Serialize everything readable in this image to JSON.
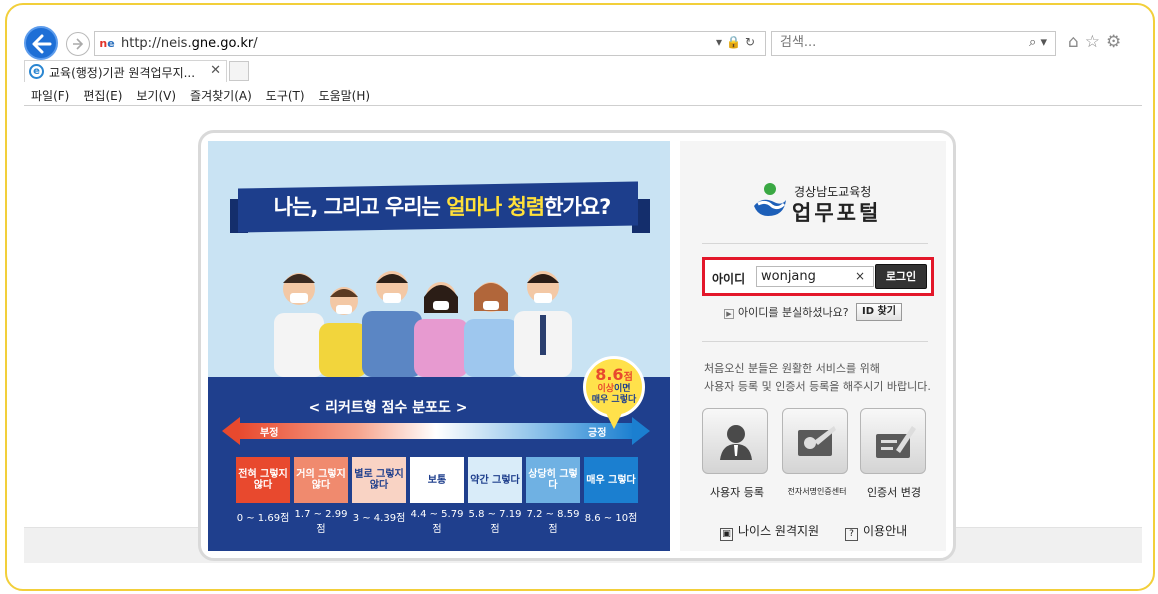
{
  "browser": {
    "url_prefix": "http://neis.",
    "url_domain": "gne.go.kr",
    "url_suffix": "/",
    "search_placeholder": "검색...",
    "tab_title": "교육(행정)기관 원격업무지...",
    "menu": [
      "파일(F)",
      "편집(E)",
      "보기(V)",
      "즐겨찾기(A)",
      "도구(T)",
      "도움말(H)"
    ]
  },
  "banner": {
    "title_pre": "나는, 그리고 우리는 ",
    "title_hl": "얼마나 청렴",
    "title_post": "한가요?",
    "likert_title": "< 리커트형 점수 분포도 >",
    "negative": "부정",
    "positive": "긍정",
    "scale": [
      {
        "label": "전혀 그렇지 않다",
        "range": "0 ~ 1.69점",
        "color": "#e8492e"
      },
      {
        "label": "거의 그렇지 않다",
        "range": "1.7 ~ 2.99점",
        "color": "#f08a6e"
      },
      {
        "label": "별로 그렇지 않다",
        "range": "3 ~ 4.39점",
        "color": "#f9d3c4"
      },
      {
        "label": "보통",
        "range": "4.4 ~ 5.79점",
        "color": "#1f3f8d"
      },
      {
        "label": "약간 그렇다",
        "range": "5.8 ~ 7.19점",
        "color": "#d9ecf9"
      },
      {
        "label": "상당히 그렇다",
        "range": "7.2 ~ 8.59점",
        "color": "#6fb1e3"
      },
      {
        "label": "매우 그렇다",
        "range": "8.6 ~ 10점",
        "color": "#1b7fd0"
      }
    ],
    "badge_score": "8.6",
    "badge_unit": "점",
    "badge_line1a": "이상",
    "badge_line1b": "이면",
    "badge_line2": "매우 그렇다"
  },
  "login": {
    "org_name": "경상남도교육청",
    "portal_name": "업무포털",
    "id_label": "아이디",
    "id_value": "wonjang",
    "clear_icon": "×",
    "login_button": "로그인",
    "forgot_text": "아이디를 분실하셨나요?",
    "find_id_button": "ID 찾기",
    "notice_line1": "처음오신 분들은 원활한 서비스를 위해",
    "notice_line2": "사용자 등록 및 인증서 등록을 해주시기 바랍니다.",
    "services": [
      "사용자 등록",
      "전자서명인증센터",
      "인증서 변경"
    ],
    "link_remote": "나이스 원격지원",
    "link_help": "이용안내"
  }
}
